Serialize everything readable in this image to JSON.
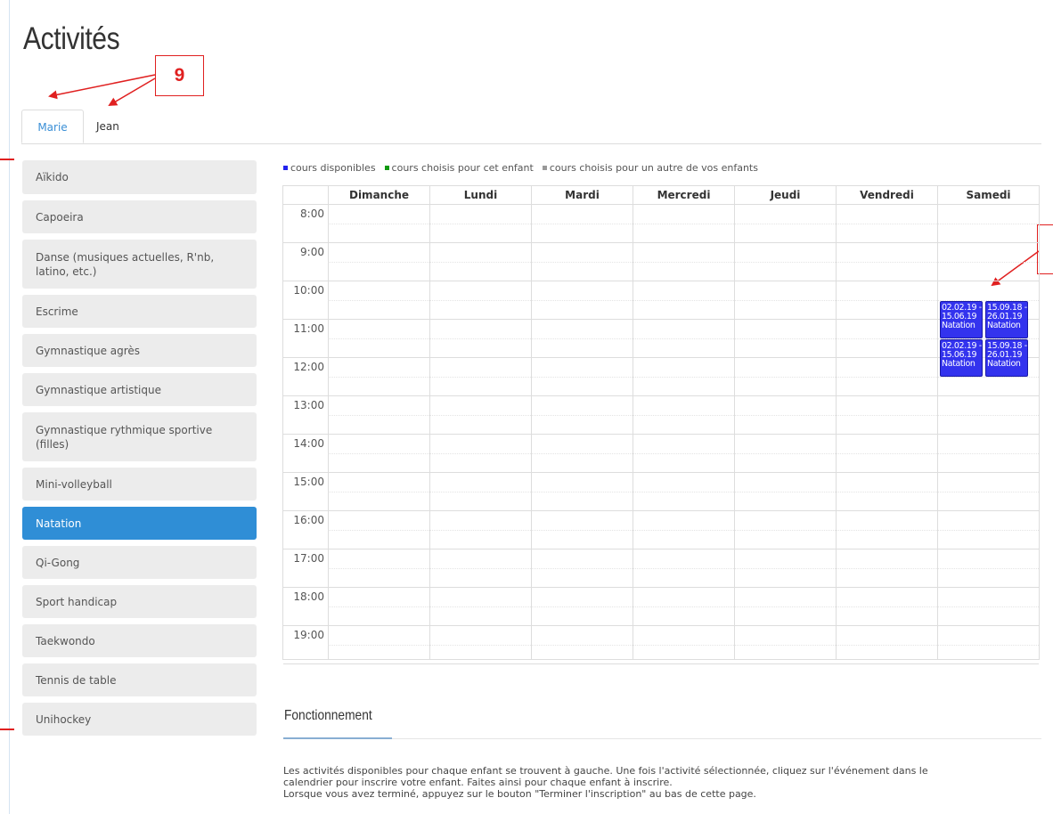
{
  "page": {
    "title": "Activités"
  },
  "annotations": {
    "callout_label": "9"
  },
  "tabs": [
    {
      "label": "Marie",
      "active": true
    },
    {
      "label": "Jean",
      "active": false
    }
  ],
  "sidebar": {
    "items": [
      {
        "label": "Aïkido"
      },
      {
        "label": "Capoeira"
      },
      {
        "label": "Danse (musiques actuelles, R'nb, latino, etc.)"
      },
      {
        "label": "Escrime"
      },
      {
        "label": "Gymnastique agrès"
      },
      {
        "label": "Gymnastique artistique"
      },
      {
        "label": "Gymnastique rythmique sportive (filles)"
      },
      {
        "label": "Mini-volleyball"
      },
      {
        "label": "Natation",
        "active": true
      },
      {
        "label": "Qi-Gong"
      },
      {
        "label": "Sport handicap"
      },
      {
        "label": "Taekwondo"
      },
      {
        "label": "Tennis de table"
      },
      {
        "label": "Unihockey"
      }
    ]
  },
  "legend": {
    "items": [
      {
        "label": "cours disponibles",
        "color": "#2222ee"
      },
      {
        "label": "cours choisis pour cet enfant",
        "color": "#119911"
      },
      {
        "label": "cours choisis pour un autre de vos enfants",
        "color": "#999999"
      }
    ]
  },
  "calendar": {
    "days": [
      "Dimanche",
      "Lundi",
      "Mardi",
      "Mercredi",
      "Jeudi",
      "Vendredi",
      "Samedi"
    ],
    "hours": [
      "8:00",
      "9:00",
      "10:00",
      "11:00",
      "12:00",
      "13:00",
      "14:00",
      "15:00",
      "16:00",
      "17:00",
      "18:00",
      "19:00"
    ],
    "events": [
      {
        "day": "Samedi",
        "start": "10:30",
        "end": "11:30",
        "dates": "02.02.19 - 15.06.19",
        "date_from": "02.02.19 -",
        "date_to": "15.06.19",
        "title": "Natation"
      },
      {
        "day": "Samedi",
        "start": "10:30",
        "end": "11:30",
        "dates": "15.09.18 - 26.01.19",
        "date_from": "15.09.18 -",
        "date_to": "26.01.19",
        "title": "Natation"
      },
      {
        "day": "Samedi",
        "start": "11:30",
        "end": "12:30",
        "dates": "02.02.19 - 15.06.19",
        "date_from": "02.02.19 -",
        "date_to": "15.06.19",
        "title": "Natation"
      },
      {
        "day": "Samedi",
        "start": "11:30",
        "end": "12:30",
        "dates": "15.09.18 - 26.01.19",
        "date_from": "15.09.18 -",
        "date_to": "26.01.19",
        "title": "Natation"
      }
    ]
  },
  "info": {
    "title": "Fonctionnement",
    "line1": "Les activités disponibles pour chaque enfant se trouvent à gauche. Une fois l'activité sélectionnée, cliquez sur l'événement dans le",
    "line2": "calendrier pour inscrire votre enfant. Faites ainsi pour chaque enfant à inscrire.",
    "line3": "Lorsque vous avez terminé, appuyez sur le bouton \"Terminer l'inscription\" au bas de cette page."
  }
}
